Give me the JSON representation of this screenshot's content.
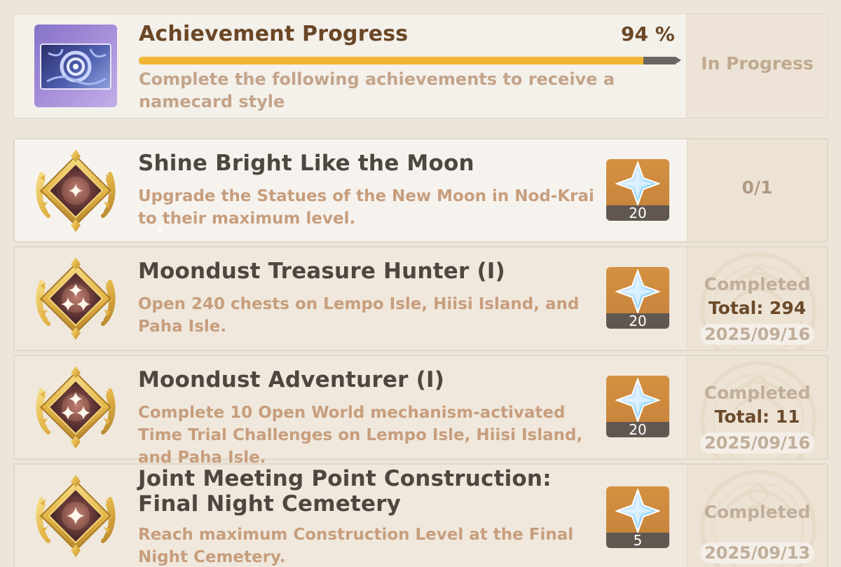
{
  "header": {
    "title": "Achievement Progress",
    "percent_label": "94 %",
    "progress": 0.94,
    "description": "Complete the following achievements to receive a namecard style",
    "status": "In Progress",
    "icon": "namecard-icon"
  },
  "achievements": [
    {
      "title": "Shine Bright Like the Moon",
      "description": "Upgrade the Statues of the New Moon in Nod-Krai to their maximum level.",
      "reward_icon": "primogem-icon",
      "reward_amount": "20",
      "count": "0/1",
      "completed": false
    },
    {
      "title": "Moondust Treasure Hunter (I)",
      "description": "Open 240 chests on Lempo Isle, Hiisi Island, and Paha Isle.",
      "reward_icon": "primogem-icon",
      "reward_amount": "20",
      "status": "Completed",
      "total": "Total: 294",
      "date": "2025/09/16",
      "completed": true
    },
    {
      "title": "Moondust Adventurer (I)",
      "description": "Complete 10 Open World mechanism-activated Time Trial Challenges on Lempo Isle, Hiisi Island, and Paha Isle.",
      "reward_icon": "primogem-icon",
      "reward_amount": "20",
      "status": "Completed",
      "total": "Total: 11",
      "date": "2025/09/16",
      "completed": true
    },
    {
      "title": "Joint Meeting Point Construction: Final Night Cemetery",
      "description": "Reach maximum Construction Level at the Final Night Cemetery.",
      "reward_icon": "primogem-icon",
      "reward_amount": "5",
      "status": "Completed",
      "date": "2025/09/13",
      "completed": true
    }
  ],
  "colors": {
    "background": "#ece5da",
    "progress_fill": "#f2b634",
    "title_brown": "#6a4726",
    "description": "#c79e7d",
    "reward_bg": "#d08c3e"
  }
}
